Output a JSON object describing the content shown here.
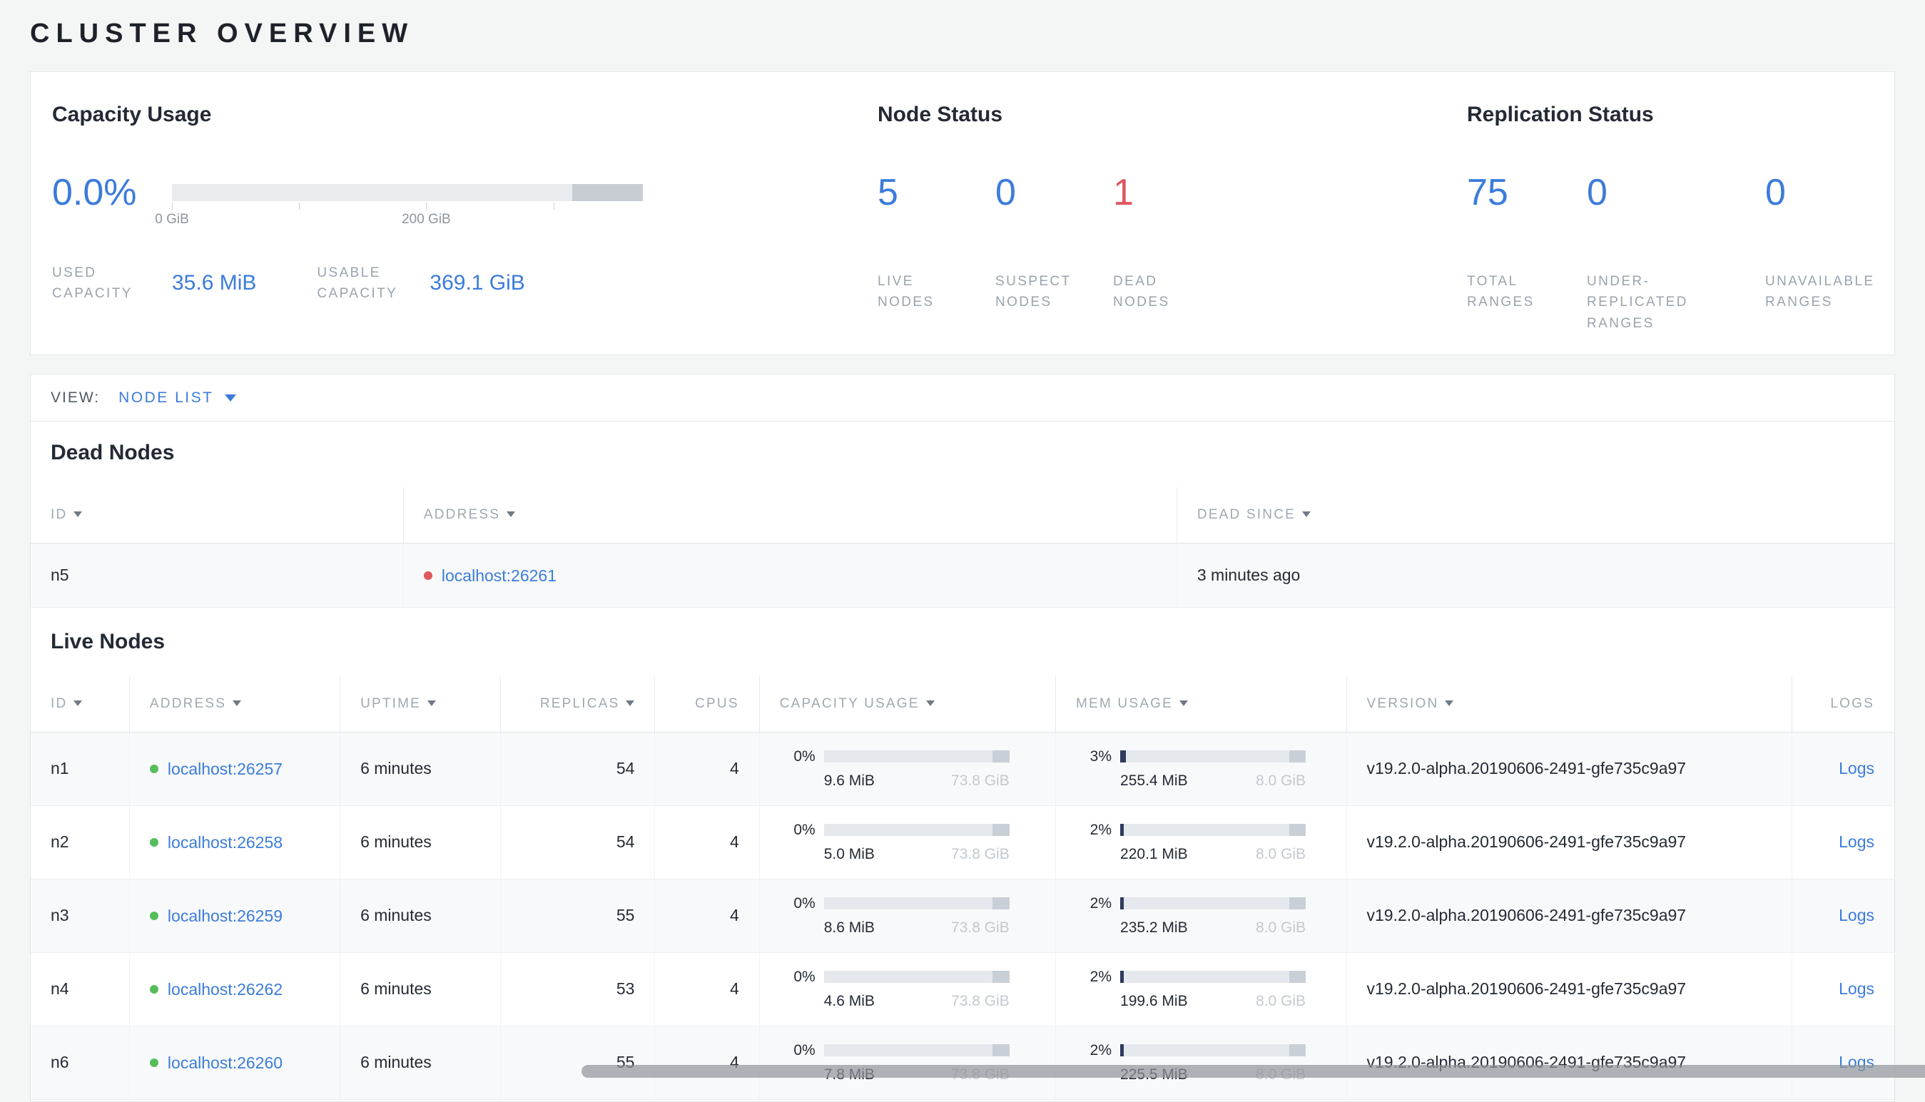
{
  "colors": {
    "blue": "#3b7cdb",
    "red": "#e0565f",
    "green": "#55bd5a"
  },
  "page": {
    "title": "CLUSTER OVERVIEW"
  },
  "summary": {
    "capacity": {
      "heading": "Capacity Usage",
      "percent": "0.0%",
      "tick_labels": [
        "0 GiB",
        "200 GiB"
      ],
      "stats": [
        {
          "label": "USED CAPACITY",
          "value": "35.6 MiB"
        },
        {
          "label": "USABLE CAPACITY",
          "value": "369.1 GiB"
        }
      ]
    },
    "node_status": {
      "heading": "Node Status",
      "stats": [
        {
          "value": "5",
          "label": "LIVE NODES"
        },
        {
          "value": "0",
          "label": "SUSPECT NODES"
        },
        {
          "value": "1",
          "label": "DEAD NODES"
        }
      ]
    },
    "replication": {
      "heading": "Replication Status",
      "stats": [
        {
          "value": "75",
          "label": "TOTAL RANGES"
        },
        {
          "value": "0",
          "label": "UNDER-REPLICATED RANGES"
        },
        {
          "value": "0",
          "label": "UNAVAILABLE RANGES"
        }
      ]
    }
  },
  "view_bar": {
    "label": "VIEW:",
    "selected": "NODE LIST"
  },
  "dead_nodes": {
    "heading": "Dead Nodes",
    "columns": [
      "ID",
      "ADDRESS",
      "DEAD SINCE"
    ],
    "rows": [
      {
        "id": "n5",
        "address": "localhost:26261",
        "dead_since": "3 minutes ago"
      }
    ]
  },
  "live_nodes": {
    "heading": "Live Nodes",
    "columns": [
      "ID",
      "ADDRESS",
      "UPTIME",
      "REPLICAS",
      "CPUS",
      "CAPACITY USAGE",
      "MEM USAGE",
      "VERSION",
      "LOGS"
    ],
    "rows": [
      {
        "id": "n1",
        "address": "localhost:26257",
        "uptime": "6 minutes",
        "replicas": "54",
        "cpus": "4",
        "capacity": {
          "percent": "0%",
          "used": "9.6 MiB",
          "total": "73.8 GiB",
          "fill": "0%"
        },
        "mem": {
          "percent": "3%",
          "used": "255.4 MiB",
          "total": "8.0 GiB",
          "fill": "3%"
        },
        "version": "v19.2.0-alpha.20190606-2491-gfe735c9a97",
        "logs": "Logs"
      },
      {
        "id": "n2",
        "address": "localhost:26258",
        "uptime": "6 minutes",
        "replicas": "54",
        "cpus": "4",
        "capacity": {
          "percent": "0%",
          "used": "5.0 MiB",
          "total": "73.8 GiB",
          "fill": "0%"
        },
        "mem": {
          "percent": "2%",
          "used": "220.1 MiB",
          "total": "8.0 GiB",
          "fill": "2%"
        },
        "version": "v19.2.0-alpha.20190606-2491-gfe735c9a97",
        "logs": "Logs"
      },
      {
        "id": "n3",
        "address": "localhost:26259",
        "uptime": "6 minutes",
        "replicas": "55",
        "cpus": "4",
        "capacity": {
          "percent": "0%",
          "used": "8.6 MiB",
          "total": "73.8 GiB",
          "fill": "0%"
        },
        "mem": {
          "percent": "2%",
          "used": "235.2 MiB",
          "total": "8.0 GiB",
          "fill": "2%"
        },
        "version": "v19.2.0-alpha.20190606-2491-gfe735c9a97",
        "logs": "Logs"
      },
      {
        "id": "n4",
        "address": "localhost:26262",
        "uptime": "6 minutes",
        "replicas": "53",
        "cpus": "4",
        "capacity": {
          "percent": "0%",
          "used": "4.6 MiB",
          "total": "73.8 GiB",
          "fill": "0%"
        },
        "mem": {
          "percent": "2%",
          "used": "199.6 MiB",
          "total": "8.0 GiB",
          "fill": "2%"
        },
        "version": "v19.2.0-alpha.20190606-2491-gfe735c9a97",
        "logs": "Logs"
      },
      {
        "id": "n6",
        "address": "localhost:26260",
        "uptime": "6 minutes",
        "replicas": "55",
        "cpus": "4",
        "capacity": {
          "percent": "0%",
          "used": "7.8 MiB",
          "total": "73.8 GiB",
          "fill": "0%"
        },
        "mem": {
          "percent": "2%",
          "used": "225.5 MiB",
          "total": "8.0 GiB",
          "fill": "2%"
        },
        "version": "v19.2.0-alpha.20190606-2491-gfe735c9a97",
        "logs": "Logs"
      }
    ]
  }
}
